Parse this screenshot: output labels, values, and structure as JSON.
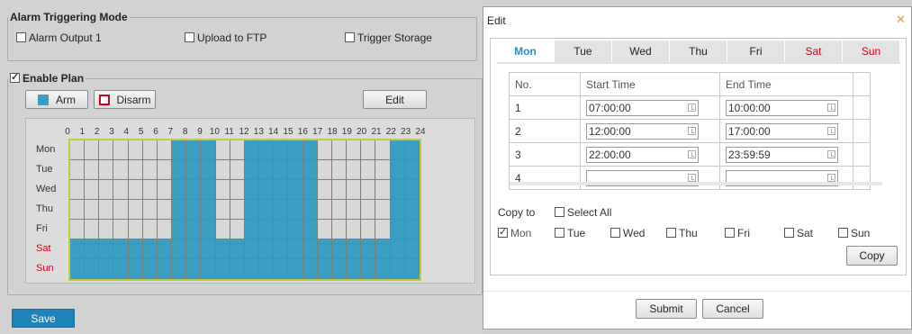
{
  "alarm_mode": {
    "legend": "Alarm Triggering Mode",
    "options": [
      {
        "label": "Alarm Output 1",
        "checked": false
      },
      {
        "label": "Upload to FTP",
        "checked": false
      },
      {
        "label": "Trigger Storage",
        "checked": false
      }
    ]
  },
  "plan": {
    "legend": "Enable Plan",
    "enabled": true,
    "arm_label": "Arm",
    "disarm_label": "Disarm",
    "edit_label": "Edit",
    "arm_color": "#3a9fc0",
    "disarm_color": "#d0021b",
    "hours": [
      "0",
      "1",
      "2",
      "3",
      "4",
      "5",
      "6",
      "7",
      "8",
      "9",
      "10",
      "11",
      "12",
      "13",
      "14",
      "15",
      "16",
      "17",
      "18",
      "19",
      "20",
      "21",
      "22",
      "23",
      "24"
    ],
    "days": [
      "Mon",
      "Tue",
      "Wed",
      "Thu",
      "Fri",
      "Sat",
      "Sun"
    ],
    "weekend_color": "#d0021b",
    "schedule": {
      "Mon": [
        [
          7,
          10
        ],
        [
          12,
          17
        ],
        [
          22,
          24
        ]
      ],
      "Tue": [
        [
          7,
          10
        ],
        [
          12,
          17
        ],
        [
          22,
          24
        ]
      ],
      "Wed": [
        [
          7,
          10
        ],
        [
          12,
          17
        ],
        [
          22,
          24
        ]
      ],
      "Thu": [
        [
          7,
          10
        ],
        [
          12,
          17
        ],
        [
          22,
          24
        ]
      ],
      "Fri": [
        [
          7,
          10
        ],
        [
          12,
          17
        ],
        [
          22,
          24
        ]
      ],
      "Sat": [
        [
          0,
          24
        ]
      ],
      "Sun": [
        [
          0,
          24
        ]
      ]
    },
    "wed_gap": [
      [
        10,
        12
      ]
    ]
  },
  "save_label": "Save",
  "dialog": {
    "title": "Edit",
    "close_icon": "close-icon",
    "tabs": [
      "Mon",
      "Tue",
      "Wed",
      "Thu",
      "Fri",
      "Sat",
      "Sun"
    ],
    "active_tab": "Mon",
    "headers": {
      "no": "No.",
      "start": "Start Time",
      "end": "End Time"
    },
    "rows": [
      {
        "no": "1",
        "start": "07:00:00",
        "end": "10:00:00"
      },
      {
        "no": "2",
        "start": "12:00:00",
        "end": "17:00:00"
      },
      {
        "no": "3",
        "start": "22:00:00",
        "end": "23:59:59"
      },
      {
        "no": "4",
        "start": "",
        "end": ""
      }
    ],
    "copy_to_label": "Copy to",
    "select_all_label": "Select All",
    "copy_days": [
      {
        "label": "Mon",
        "checked": true
      },
      {
        "label": "Tue",
        "checked": false
      },
      {
        "label": "Wed",
        "checked": false
      },
      {
        "label": "Thu",
        "checked": false
      },
      {
        "label": "Fri",
        "checked": false
      },
      {
        "label": "Sat",
        "checked": false
      },
      {
        "label": "Sun",
        "checked": false
      }
    ],
    "copy_label": "Copy",
    "submit_label": "Submit",
    "cancel_label": "Cancel"
  }
}
